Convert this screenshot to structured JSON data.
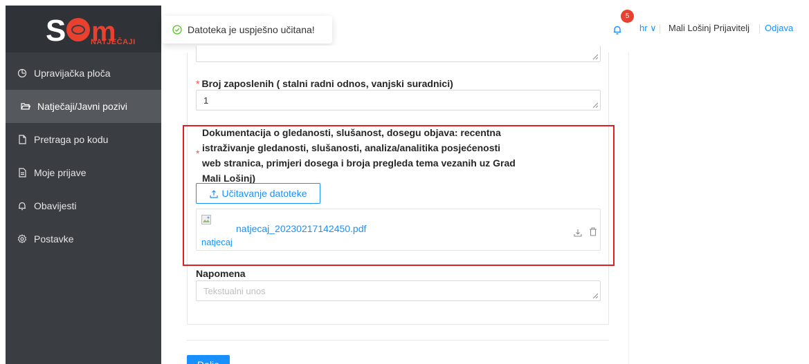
{
  "logo": {
    "subtitle": "NATJEČAJI"
  },
  "sidebar": {
    "items": [
      {
        "label": "Upravijačka ploča",
        "icon": "dashboard-icon"
      },
      {
        "label": "Natječaji/Javni pozivi",
        "icon": "folder-open-icon",
        "active": true
      },
      {
        "label": "Pretraga po kodu",
        "icon": "file-icon"
      },
      {
        "label": "Moje prijave",
        "icon": "file-text-icon"
      },
      {
        "label": "Obavijesti",
        "icon": "bell-icon"
      },
      {
        "label": "Postavke",
        "icon": "gear-icon"
      }
    ]
  },
  "header": {
    "notification_count": "5",
    "language": "hr ∨",
    "user": "Mali Lošinj Prijavitelj",
    "logout": "Odjava"
  },
  "toast": {
    "message": "Datoteka je uspješno učitana!"
  },
  "form": {
    "employees_label": "Broj zaposlenih ( stalni radni odnos, vanjski suradnici)",
    "employees_value": "1",
    "doc_label_line1": "Dokumentacija o gledanosti, slušanost, dosegu objava: recentna",
    "doc_label_line2": "istraživanje gledanosti, slušanosti, analiza/analitika posjećenosti",
    "doc_label_line3": "web stranica, primjeri dosega i broja pregleda tema vezanih uz Grad",
    "doc_label_line4": "Mali Lošinj)",
    "upload_label": "Učitavanje datoteke",
    "file_name": "natjecaj_20230217142450.pdf",
    "file_thumb_alt": "natjecaj",
    "note_label": "Napomena",
    "note_placeholder": "Tekstualni unos",
    "submit_label": "Dalje"
  },
  "colors": {
    "accent": "#1890ff",
    "sidebar": "#3a3d41",
    "brand_red": "#e8412f",
    "highlight_border": "#e02020"
  }
}
